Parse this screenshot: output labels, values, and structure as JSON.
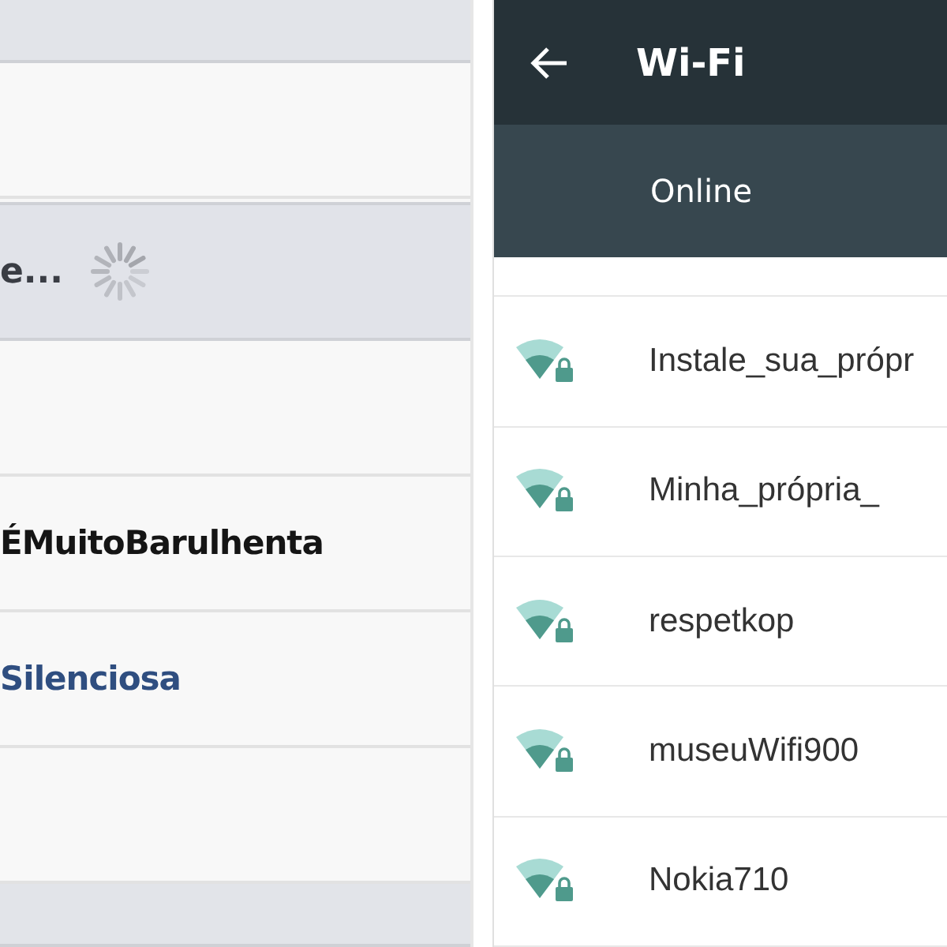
{
  "left_panel": {
    "loading_text": "e...",
    "rows": [
      {
        "kind": "empty"
      },
      {
        "kind": "dark",
        "name": "ÉMuitoBarulhenta"
      },
      {
        "kind": "link",
        "name": "Silenciosa"
      },
      {
        "kind": "empty"
      }
    ]
  },
  "right_panel": {
    "title": "Wi-Fi",
    "status": "Online",
    "networks": [
      {
        "name": "Instale_sua_própr"
      },
      {
        "name": "Minha_própria_"
      },
      {
        "name": "respetkop"
      },
      {
        "name": "museuWifi900"
      },
      {
        "name": "Nokia710"
      }
    ]
  }
}
